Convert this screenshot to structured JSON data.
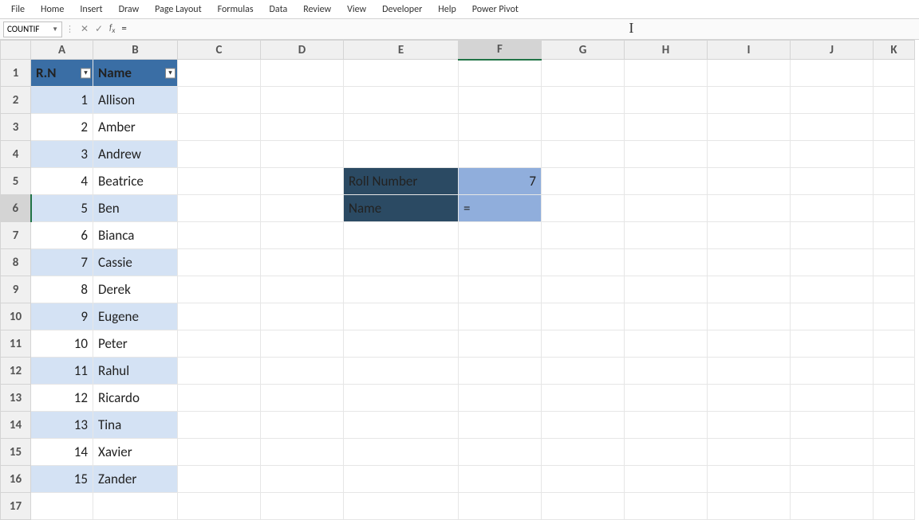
{
  "ribbon": {
    "tabs": [
      "File",
      "Home",
      "Insert",
      "Draw",
      "Page Layout",
      "Formulas",
      "Data",
      "Review",
      "View",
      "Developer",
      "Help",
      "Power Pivot"
    ]
  },
  "name_box": "COUNTIF",
  "formula_bar": "=",
  "columns": [
    "A",
    "B",
    "C",
    "D",
    "E",
    "F",
    "G",
    "H",
    "I",
    "J",
    "K"
  ],
  "row_count": 17,
  "active_col": "F",
  "active_row": 6,
  "table": {
    "header_rn": "R.N",
    "header_name": "Name",
    "rows": [
      {
        "rn": "1",
        "name": "Allison"
      },
      {
        "rn": "2",
        "name": "Amber"
      },
      {
        "rn": "3",
        "name": "Andrew"
      },
      {
        "rn": "4",
        "name": "Beatrice"
      },
      {
        "rn": "5",
        "name": "Ben"
      },
      {
        "rn": "6",
        "name": "Bianca"
      },
      {
        "rn": "7",
        "name": "Cassie"
      },
      {
        "rn": "8",
        "name": "Derek"
      },
      {
        "rn": "9",
        "name": "Eugene"
      },
      {
        "rn": "10",
        "name": "Peter"
      },
      {
        "rn": "11",
        "name": "Rahul"
      },
      {
        "rn": "12",
        "name": "Ricardo"
      },
      {
        "rn": "13",
        "name": "Tina"
      },
      {
        "rn": "14",
        "name": "Xavier"
      },
      {
        "rn": "15",
        "name": "Zander"
      }
    ]
  },
  "lookup": {
    "roll_label": "Roll Number",
    "roll_value": "7",
    "name_label": "Name",
    "name_value": "="
  }
}
